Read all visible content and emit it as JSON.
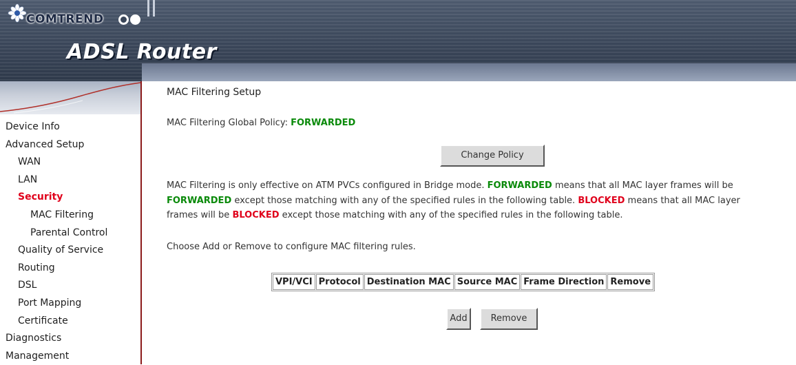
{
  "header": {
    "brand": "COMTREND",
    "product": "ADSL Router"
  },
  "sidebar": {
    "items": [
      {
        "label": "Device Info",
        "level": 1,
        "active": false
      },
      {
        "label": "Advanced Setup",
        "level": 1,
        "active": false
      },
      {
        "label": "WAN",
        "level": 2,
        "active": false
      },
      {
        "label": "LAN",
        "level": 2,
        "active": false
      },
      {
        "label": "Security",
        "level": 2,
        "active": true
      },
      {
        "label": "MAC Filtering",
        "level": 3,
        "active": false
      },
      {
        "label": "Parental Control",
        "level": 3,
        "active": false
      },
      {
        "label": "Quality of Service",
        "level": 2,
        "active": false
      },
      {
        "label": "Routing",
        "level": 2,
        "active": false
      },
      {
        "label": "DSL",
        "level": 2,
        "active": false
      },
      {
        "label": "Port Mapping",
        "level": 2,
        "active": false
      },
      {
        "label": "Certificate",
        "level": 2,
        "active": false
      },
      {
        "label": "Diagnostics",
        "level": 1,
        "active": false
      },
      {
        "label": "Management",
        "level": 1,
        "active": false
      }
    ]
  },
  "main": {
    "title": "MAC Filtering Setup",
    "policy_label": "MAC Filtering Global Policy:",
    "policy_value": "FORWARDED",
    "change_policy_button": "Change Policy",
    "description": {
      "line1_a": "MAC Filtering is only effective on ATM PVCs configured in Bridge mode.",
      "line1_kw": "FORWARDED",
      "line1_b": "means that all MAC layer frames will be",
      "line2_kw": "FORWARDED",
      "line2_a": "except those matching with any of the specified rules in the following table.",
      "line2_kw2": "BLOCKED",
      "line2_b": "means that all MAC layer",
      "line3_a": "frames will be",
      "line3_kw": "BLOCKED",
      "line3_b": "except those matching with any of the specified rules in the following table."
    },
    "instruction": "Choose Add or Remove to configure MAC filtering rules.",
    "table": {
      "headers": [
        "VPI/VCI",
        "Protocol",
        "Destination MAC",
        "Source MAC",
        "Frame Direction",
        "Remove"
      ],
      "rows": []
    },
    "add_button": "Add",
    "remove_button": "Remove"
  },
  "colors": {
    "forwarded": "#0a8a0a",
    "blocked": "#e0001b",
    "active_nav": "#e0001b",
    "sidebar_border": "#8b1a1a"
  }
}
